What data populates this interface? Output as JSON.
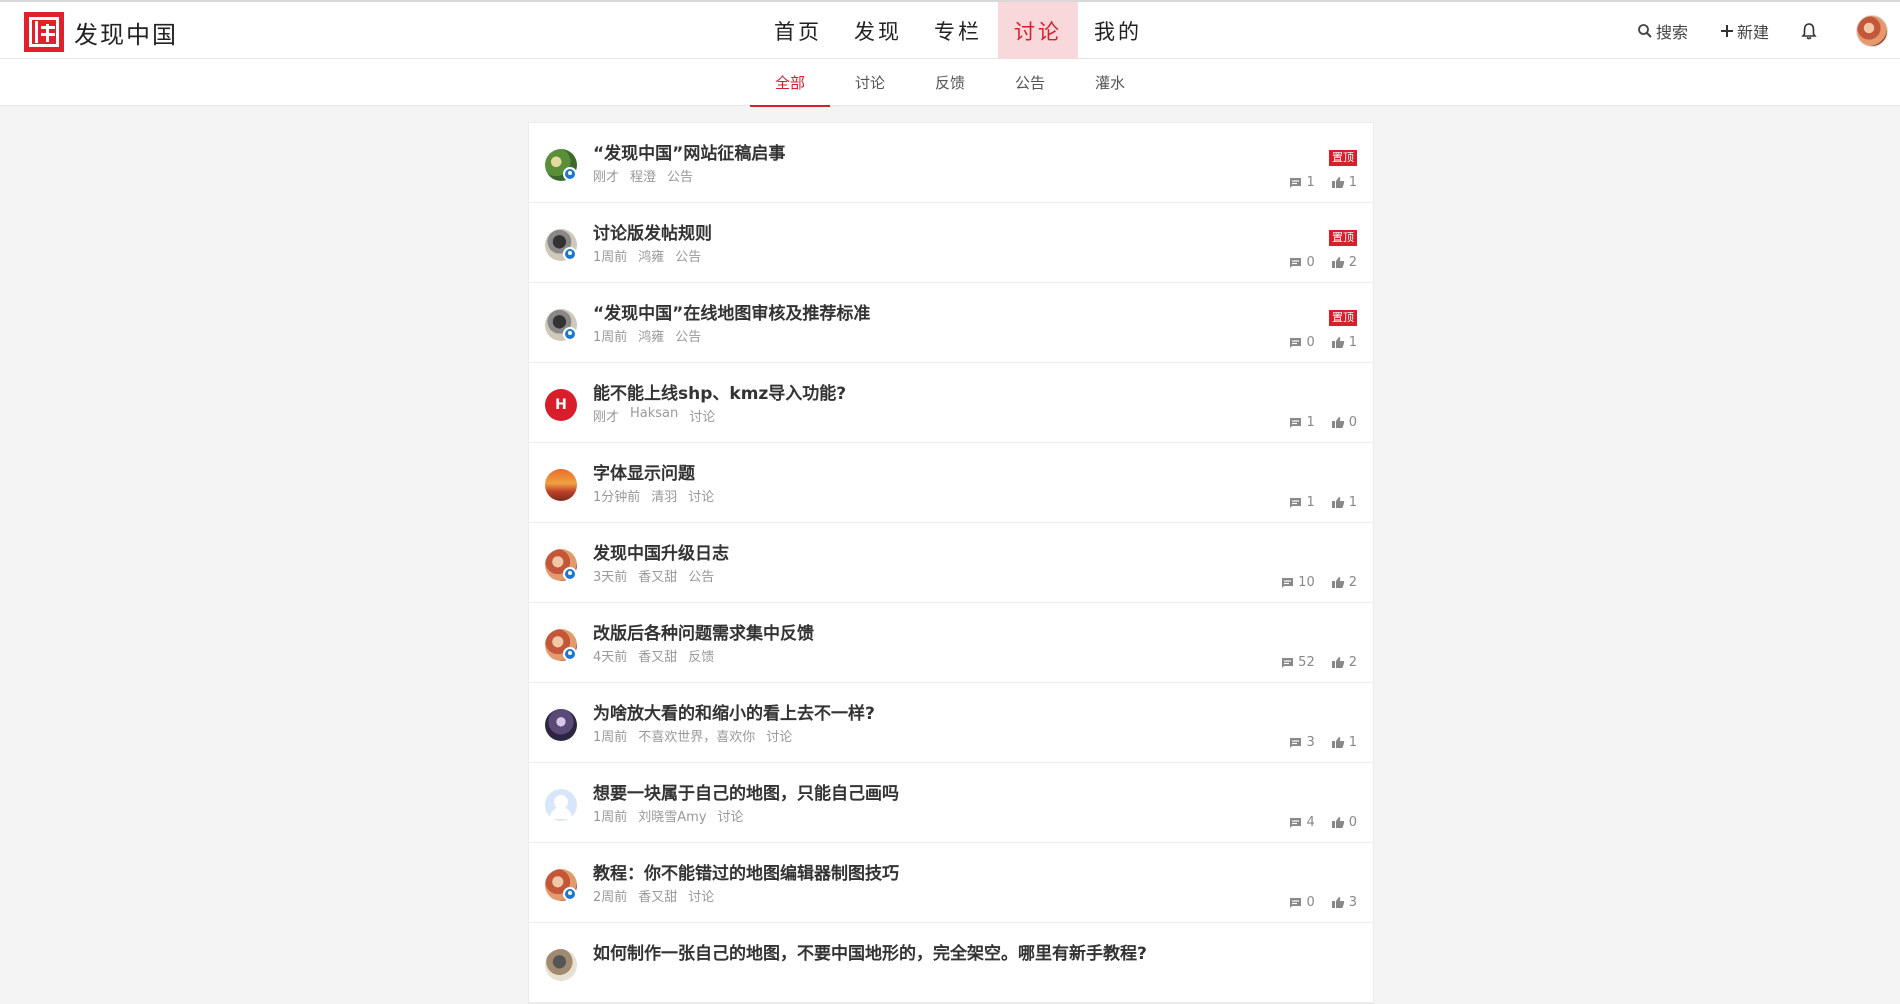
{
  "brand": {
    "name": "发现中国"
  },
  "main_nav": [
    {
      "label": "首页",
      "active": false
    },
    {
      "label": "发现",
      "active": false
    },
    {
      "label": "专栏",
      "active": false
    },
    {
      "label": "讨论",
      "active": true
    },
    {
      "label": "我的",
      "active": false
    }
  ],
  "right_nav": {
    "search_label": "搜索",
    "new_label": "新建"
  },
  "sub_tabs": [
    {
      "label": "全部",
      "active": true
    },
    {
      "label": "讨论",
      "active": false
    },
    {
      "label": "反馈",
      "active": false
    },
    {
      "label": "公告",
      "active": false
    },
    {
      "label": "灌水",
      "active": false
    }
  ],
  "colors": {
    "accent": "#d81e2a",
    "badge": "#1b78d2"
  },
  "posts": [
    {
      "title": "“发现中国”网站征稿启事",
      "time": "刚才",
      "author": "程澄",
      "category": "公告",
      "pinned": true,
      "pin_label": "置顶",
      "comments": "1",
      "likes": "1",
      "avatar": "green",
      "verified": true
    },
    {
      "title": "讨论版发帖规则",
      "time": "1周前",
      "author": "鸿雍",
      "category": "公告",
      "pinned": true,
      "pin_label": "置顶",
      "comments": "0",
      "likes": "2",
      "avatar": "dark",
      "verified": true
    },
    {
      "title": "“发现中国”在线地图审核及推荐标准",
      "time": "1周前",
      "author": "鸿雍",
      "category": "公告",
      "pinned": true,
      "pin_label": "置顶",
      "comments": "0",
      "likes": "1",
      "avatar": "dark",
      "verified": true
    },
    {
      "title": "能不能上线shp、kmz导入功能?",
      "time": "刚才",
      "author": "Haksan",
      "category": "讨论",
      "pinned": false,
      "comments": "1",
      "likes": "0",
      "avatar": "red",
      "avatar_letter": "H",
      "verified": false
    },
    {
      "title": "字体显示问题",
      "time": "1分钟前",
      "author": "清羽",
      "category": "讨论",
      "pinned": false,
      "comments": "1",
      "likes": "1",
      "avatar": "sunset",
      "verified": false
    },
    {
      "title": "发现中国升级日志",
      "time": "3天前",
      "author": "香又甜",
      "category": "公告",
      "pinned": false,
      "comments": "10",
      "likes": "2",
      "avatar": "peach",
      "verified": true
    },
    {
      "title": "改版后各种问题需求集中反馈",
      "time": "4天前",
      "author": "香又甜",
      "category": "反馈",
      "pinned": false,
      "comments": "52",
      "likes": "2",
      "avatar": "peach",
      "verified": true
    },
    {
      "title": "为啥放大看的和缩小的看上去不一样?",
      "time": "1周前",
      "author": "不喜欢世界，喜欢你",
      "category": "讨论",
      "pinned": false,
      "comments": "3",
      "likes": "1",
      "avatar": "purple",
      "verified": false
    },
    {
      "title": "想要一块属于自己的地图，只能自己画吗",
      "time": "1周前",
      "author": "刘晓雪Amy",
      "category": "讨论",
      "pinned": false,
      "comments": "4",
      "likes": "0",
      "avatar": "blue",
      "verified": false
    },
    {
      "title": "教程：你不能错过的地图编辑器制图技巧",
      "time": "2周前",
      "author": "香又甜",
      "category": "讨论",
      "pinned": false,
      "comments": "0",
      "likes": "3",
      "avatar": "peach",
      "verified": true
    },
    {
      "title": "如何制作一张自己的地图，不要中国地形的，完全架空。哪里有新手教程?",
      "time": "",
      "author": "",
      "category": "",
      "pinned": false,
      "comments": "",
      "likes": "",
      "avatar": "brown",
      "verified": false
    }
  ]
}
